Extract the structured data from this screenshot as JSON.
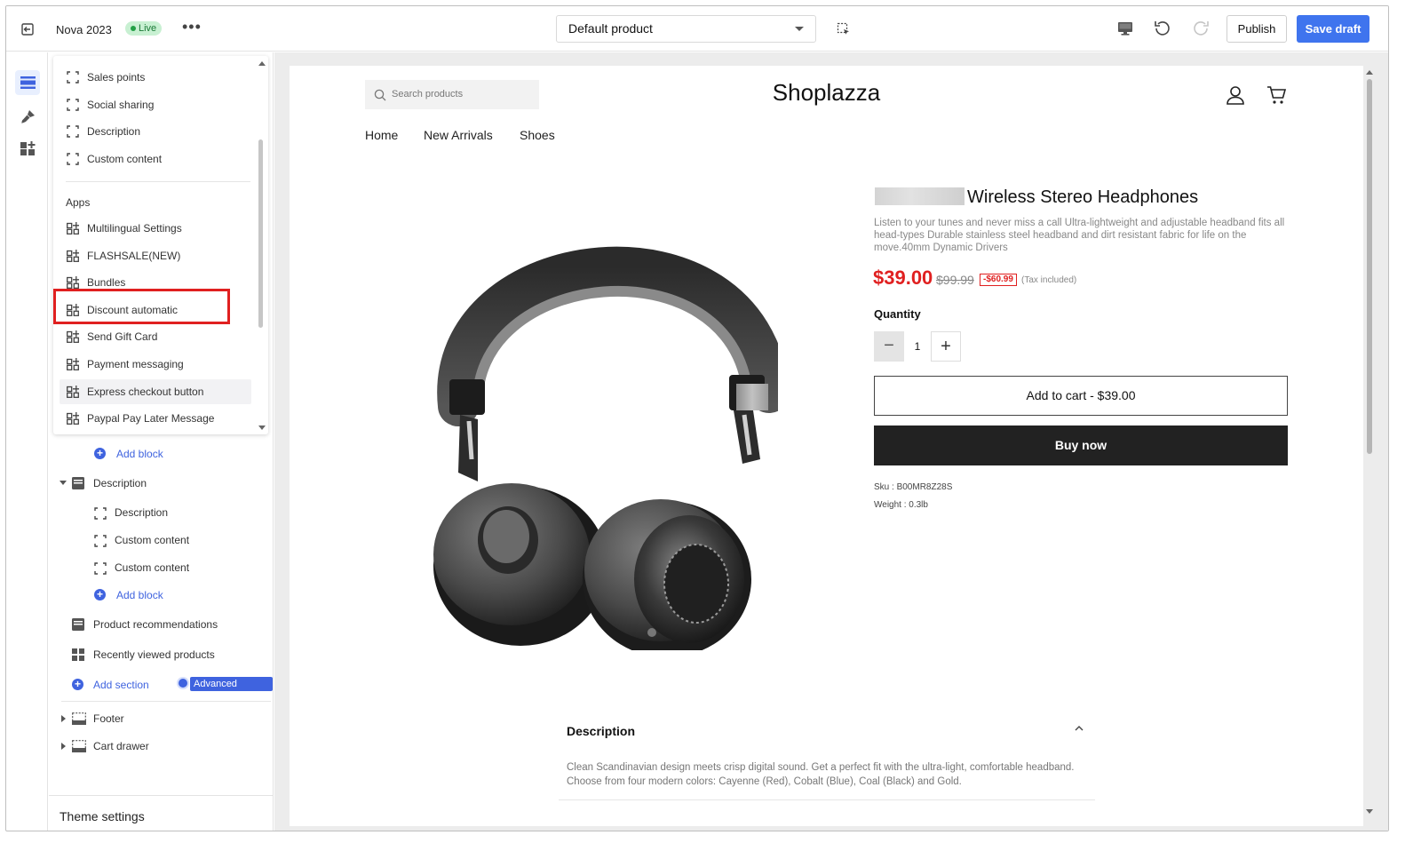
{
  "topbar": {
    "store_name": "Nova 2023",
    "status": "Live",
    "more": "•••",
    "template_select": "Default product",
    "publish_label": "Publish",
    "save_label": "Save draft"
  },
  "popup": {
    "items_top": [
      {
        "label": "Sales points",
        "icon": "block-icon"
      },
      {
        "label": "Social sharing",
        "icon": "block-icon"
      },
      {
        "label": "Description",
        "icon": "block-icon"
      },
      {
        "label": "Custom content",
        "icon": "block-icon"
      }
    ],
    "apps_heading": "Apps",
    "apps": [
      {
        "label": "Multilingual Settings",
        "icon": "app-icon"
      },
      {
        "label": "FLASHSALE(NEW)",
        "icon": "app-icon"
      },
      {
        "label": "Bundles",
        "icon": "app-icon"
      },
      {
        "label": "Discount automatic",
        "icon": "app-icon"
      },
      {
        "label": "Send Gift Card",
        "icon": "app-icon"
      },
      {
        "label": "Payment messaging",
        "icon": "app-icon"
      },
      {
        "label": "Express checkout button",
        "icon": "app-icon"
      },
      {
        "label": "Paypal Pay Later Message",
        "icon": "app-icon"
      }
    ]
  },
  "sidebar": {
    "add_block_1": "Add block",
    "description_section": "Description",
    "desc_blocks": [
      "Description",
      "Custom content",
      "Custom content"
    ],
    "add_block_2": "Add block",
    "product_recommendations": "Product recommendations",
    "recently_viewed": "Recently viewed products",
    "add_section": "Add section",
    "advanced_widgets": "Advanced widgets",
    "footer": "Footer",
    "cart_drawer": "Cart drawer",
    "theme_settings": "Theme settings"
  },
  "store": {
    "search_placeholder": "Search products",
    "logo": "Shoplazza",
    "nav": [
      "Home",
      "New Arrivals",
      "Shoes"
    ],
    "product_title": "Wireless Stereo Headphones",
    "product_desc": "Listen to your tunes and never miss a call Ultra-lightweight and adjustable headband fits all head-types Durable stainless steel headband and dirt resistant fabric for life on the move.40mm Dynamic Drivers",
    "price": "$39.00",
    "original_price": "$99.99",
    "discount": "-$60.99",
    "tax_note": "(Tax included)",
    "quantity_label": "Quantity",
    "quantity": "1",
    "add_to_cart": "Add to cart  -  $39.00",
    "buy_now": "Buy now",
    "sku": "Sku : B00MR8Z28S",
    "weight": "Weight : 0.3lb",
    "desc_heading": "Description",
    "desc_body": "Clean Scandinavian design meets crisp digital sound. Get a perfect fit with the ultra-light, comfortable headband. Choose from four modern colors: Cayenne (Red), Cobalt (Blue), Coal (Black) and Gold."
  },
  "colors": {
    "accent": "#3f74ee",
    "highlight": "#e02020",
    "live": "#22a045"
  }
}
